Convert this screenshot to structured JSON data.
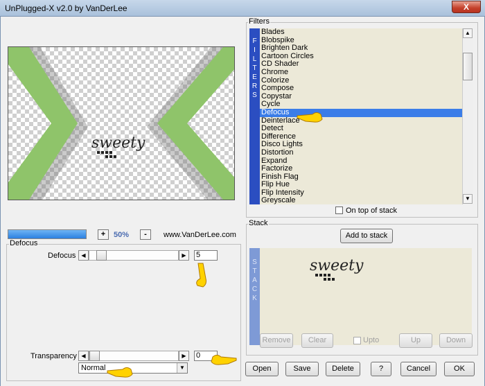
{
  "window": {
    "title": "UnPlugged-X v2.0 by VanDerLee",
    "close_label": "X"
  },
  "preview": {
    "watermark_text": "sweety"
  },
  "zoom": {
    "plus_label": "+",
    "value": "50%",
    "minus_label": "-",
    "progress": 1.0
  },
  "website": "www.VanDerLee.com",
  "defocus_group": {
    "legend": "Defocus",
    "param_label": "Defocus",
    "value": "5",
    "transparency_label": "Transparency",
    "transparency_value": "0",
    "blend_mode": "Normal"
  },
  "filters": {
    "legend": "Filters",
    "side_letters": [
      "F",
      "I",
      "L",
      "T",
      "E",
      "R",
      "S"
    ],
    "items": [
      "Blades",
      "Blobspike",
      "Brighten Dark",
      "Cartoon Circles",
      "CD Shader",
      "Chrome",
      "Colorize",
      "Compose",
      "Copystar",
      "Cycle",
      "Defocus",
      "Deinterlace",
      "Detect",
      "Difference",
      "Disco Lights",
      "Distortion",
      "Expand",
      "Factorize",
      "Finish Flag",
      "Flip Hue",
      "Flip Intensity",
      "Greyscale"
    ],
    "selected": "Defocus",
    "on_top_label": "On top of stack"
  },
  "stack": {
    "legend": "Stack",
    "add_label": "Add to stack",
    "side_letters": [
      "S",
      "T",
      "A",
      "C",
      "K"
    ],
    "thumb_text": "sweety",
    "remove_label": "Remove",
    "clear_label": "Clear",
    "upto_label": "Upto",
    "up_label": "Up",
    "down_label": "Down"
  },
  "buttons": {
    "open": "Open",
    "save": "Save",
    "delete": "Delete",
    "help": "?",
    "cancel": "Cancel",
    "ok": "OK"
  },
  "colors": {
    "accent": "#3b7de8",
    "sidebar": "#2b4ec1",
    "chevron": "#8fc46a"
  }
}
